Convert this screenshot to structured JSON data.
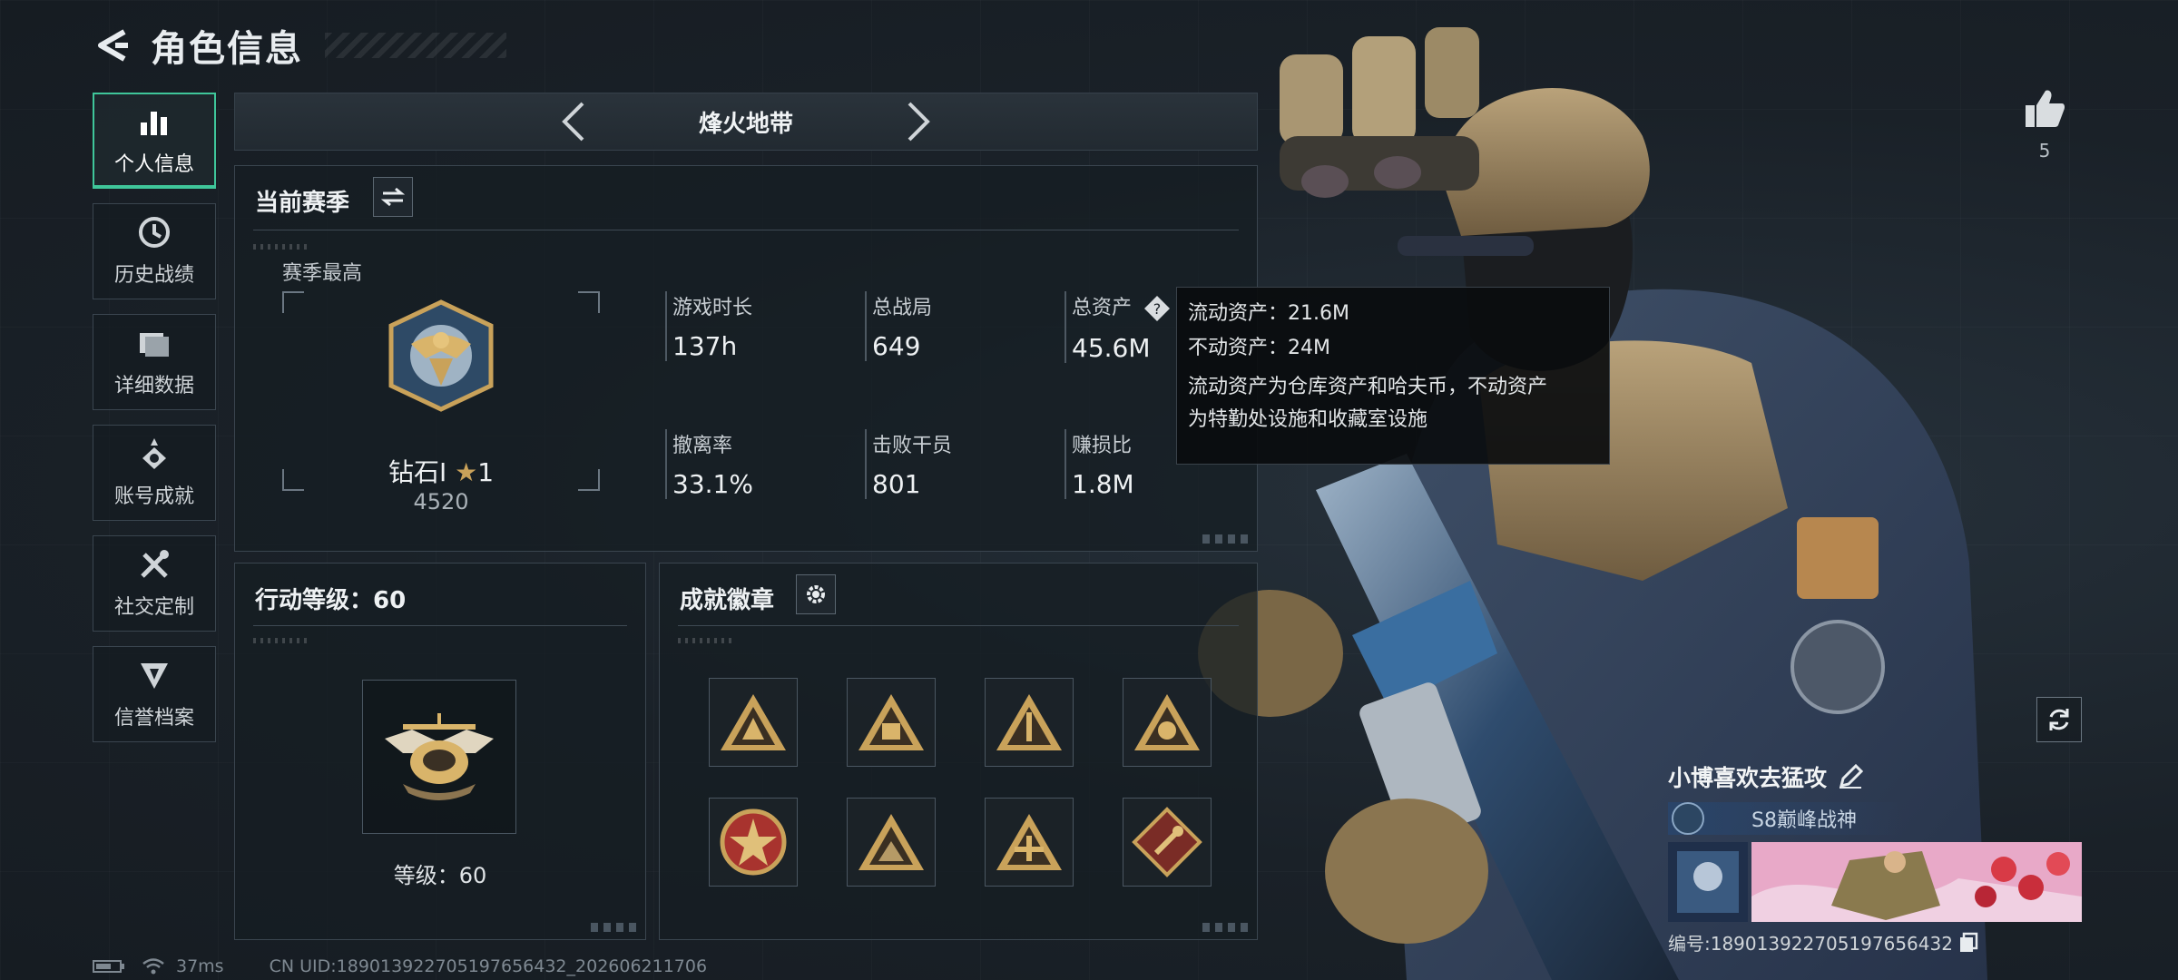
{
  "header": {
    "title": "角色信息"
  },
  "sidebar": {
    "items": [
      {
        "label": "个人信息",
        "icon": "bar-chart-icon",
        "active": true
      },
      {
        "label": "历史战绩",
        "icon": "history-icon",
        "active": false
      },
      {
        "label": "详细数据",
        "icon": "folder-icon",
        "active": false
      },
      {
        "label": "账号成就",
        "icon": "achievement-icon",
        "active": false
      },
      {
        "label": "社交定制",
        "icon": "tools-icon",
        "active": false
      },
      {
        "label": "信誉档案",
        "icon": "credit-shield-icon",
        "active": false
      }
    ]
  },
  "mode": {
    "title": "烽火地带"
  },
  "season": {
    "title": "当前赛季",
    "best_label": "赛季最高",
    "rank_name": "钻石I",
    "rank_stars": "1",
    "rank_points": "4520",
    "stats": [
      {
        "label": "游戏时长",
        "value": "137h"
      },
      {
        "label": "总战局",
        "value": "649"
      },
      {
        "label": "总资产",
        "value": "45.6M"
      },
      {
        "label": "撤离率",
        "value": "33.1%"
      },
      {
        "label": "击败干员",
        "value": "801"
      },
      {
        "label": "赚损比",
        "value": "1.8M"
      }
    ]
  },
  "tooltip": {
    "liquid": "流动资产：21.6M",
    "fixed": "不动资产：24M",
    "desc_line1": "流动资产为仓库资产和哈夫币，不动资产",
    "desc_line2": "为特勤处设施和收藏室设施"
  },
  "level": {
    "title": "行动等级：60",
    "text": "等级：60"
  },
  "badges": {
    "title": "成就徽章",
    "items": [
      "badge-1",
      "badge-2",
      "badge-3",
      "badge-4",
      "badge-5",
      "badge-6",
      "badge-7",
      "badge-8"
    ]
  },
  "likes": {
    "count": "5"
  },
  "player": {
    "name": "小博喜欢去猛攻",
    "title": "S8巅峰战神",
    "id_text": "编号:18901392270519765643​2"
  },
  "status": {
    "ping": "37ms",
    "uid": "CN UID:18901392270519765643​2_202606211706"
  },
  "colors": {
    "accent": "#3fc69a",
    "background": "#1a2128",
    "gold": "#c9a25a"
  }
}
